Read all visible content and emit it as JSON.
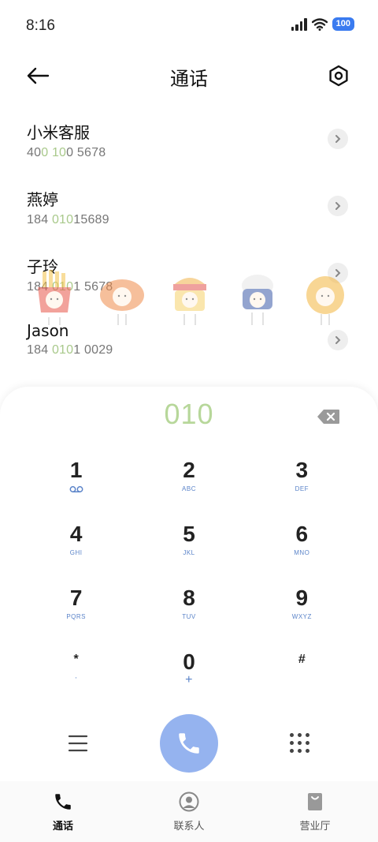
{
  "status": {
    "time": "8:16",
    "battery": "100"
  },
  "header": {
    "title": "通话",
    "back_icon": "arrow-left-icon",
    "settings_icon": "settings-hexagon-icon"
  },
  "contacts": [
    {
      "name": "小米客服",
      "number_parts": [
        "40",
        "0 10",
        "0 5678"
      ]
    },
    {
      "name": "燕婷",
      "number_parts": [
        "184 ",
        "010",
        "15689"
      ]
    },
    {
      "name": "子玲",
      "number_parts": [
        "184 ",
        "010",
        "1 5678"
      ]
    },
    {
      "name": "Jason",
      "number_parts": [
        "184 ",
        "010",
        "1 0029"
      ]
    }
  ],
  "dialer": {
    "input": "010",
    "keys": [
      {
        "digit": "1",
        "sub": "voicemail-icon"
      },
      {
        "digit": "2",
        "sub": "ABC"
      },
      {
        "digit": "3",
        "sub": "DEF"
      },
      {
        "digit": "4",
        "sub": "GHI"
      },
      {
        "digit": "5",
        "sub": "JKL"
      },
      {
        "digit": "6",
        "sub": "MNO"
      },
      {
        "digit": "7",
        "sub": "PQRS"
      },
      {
        "digit": "8",
        "sub": "TUV"
      },
      {
        "digit": "9",
        "sub": "WXYZ"
      },
      {
        "digit": "*",
        "sub": ","
      },
      {
        "digit": "0",
        "sub": "+"
      },
      {
        "digit": "#",
        "sub": ""
      }
    ]
  },
  "colors": {
    "accent": "#95b3ef",
    "match_highlight": "#a9c98b",
    "sub_label": "#5b84c9"
  },
  "nav": {
    "items": [
      {
        "label": "通话",
        "icon": "phone-icon",
        "active": true
      },
      {
        "label": "联系人",
        "icon": "contact-icon",
        "active": false
      },
      {
        "label": "营业厅",
        "icon": "shopping-bag-icon",
        "active": false
      }
    ]
  }
}
